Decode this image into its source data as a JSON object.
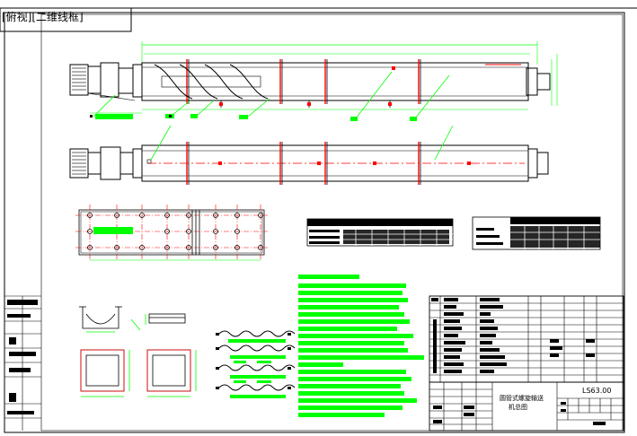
{
  "viewport": {
    "label": "[俯视][二维线框]"
  },
  "drawing": {
    "code": "LS63.00",
    "title_lines": [
      "圆管式螺旋输送",
      "机总图"
    ]
  },
  "colors": {
    "outline": "#000000",
    "green": "#00ff00",
    "red": "#ff0000",
    "magenta": "#ff00ff",
    "blue": "#0000ff",
    "navy": "#000080",
    "yellow": "#ffff00",
    "cyan": "#00ffff"
  }
}
